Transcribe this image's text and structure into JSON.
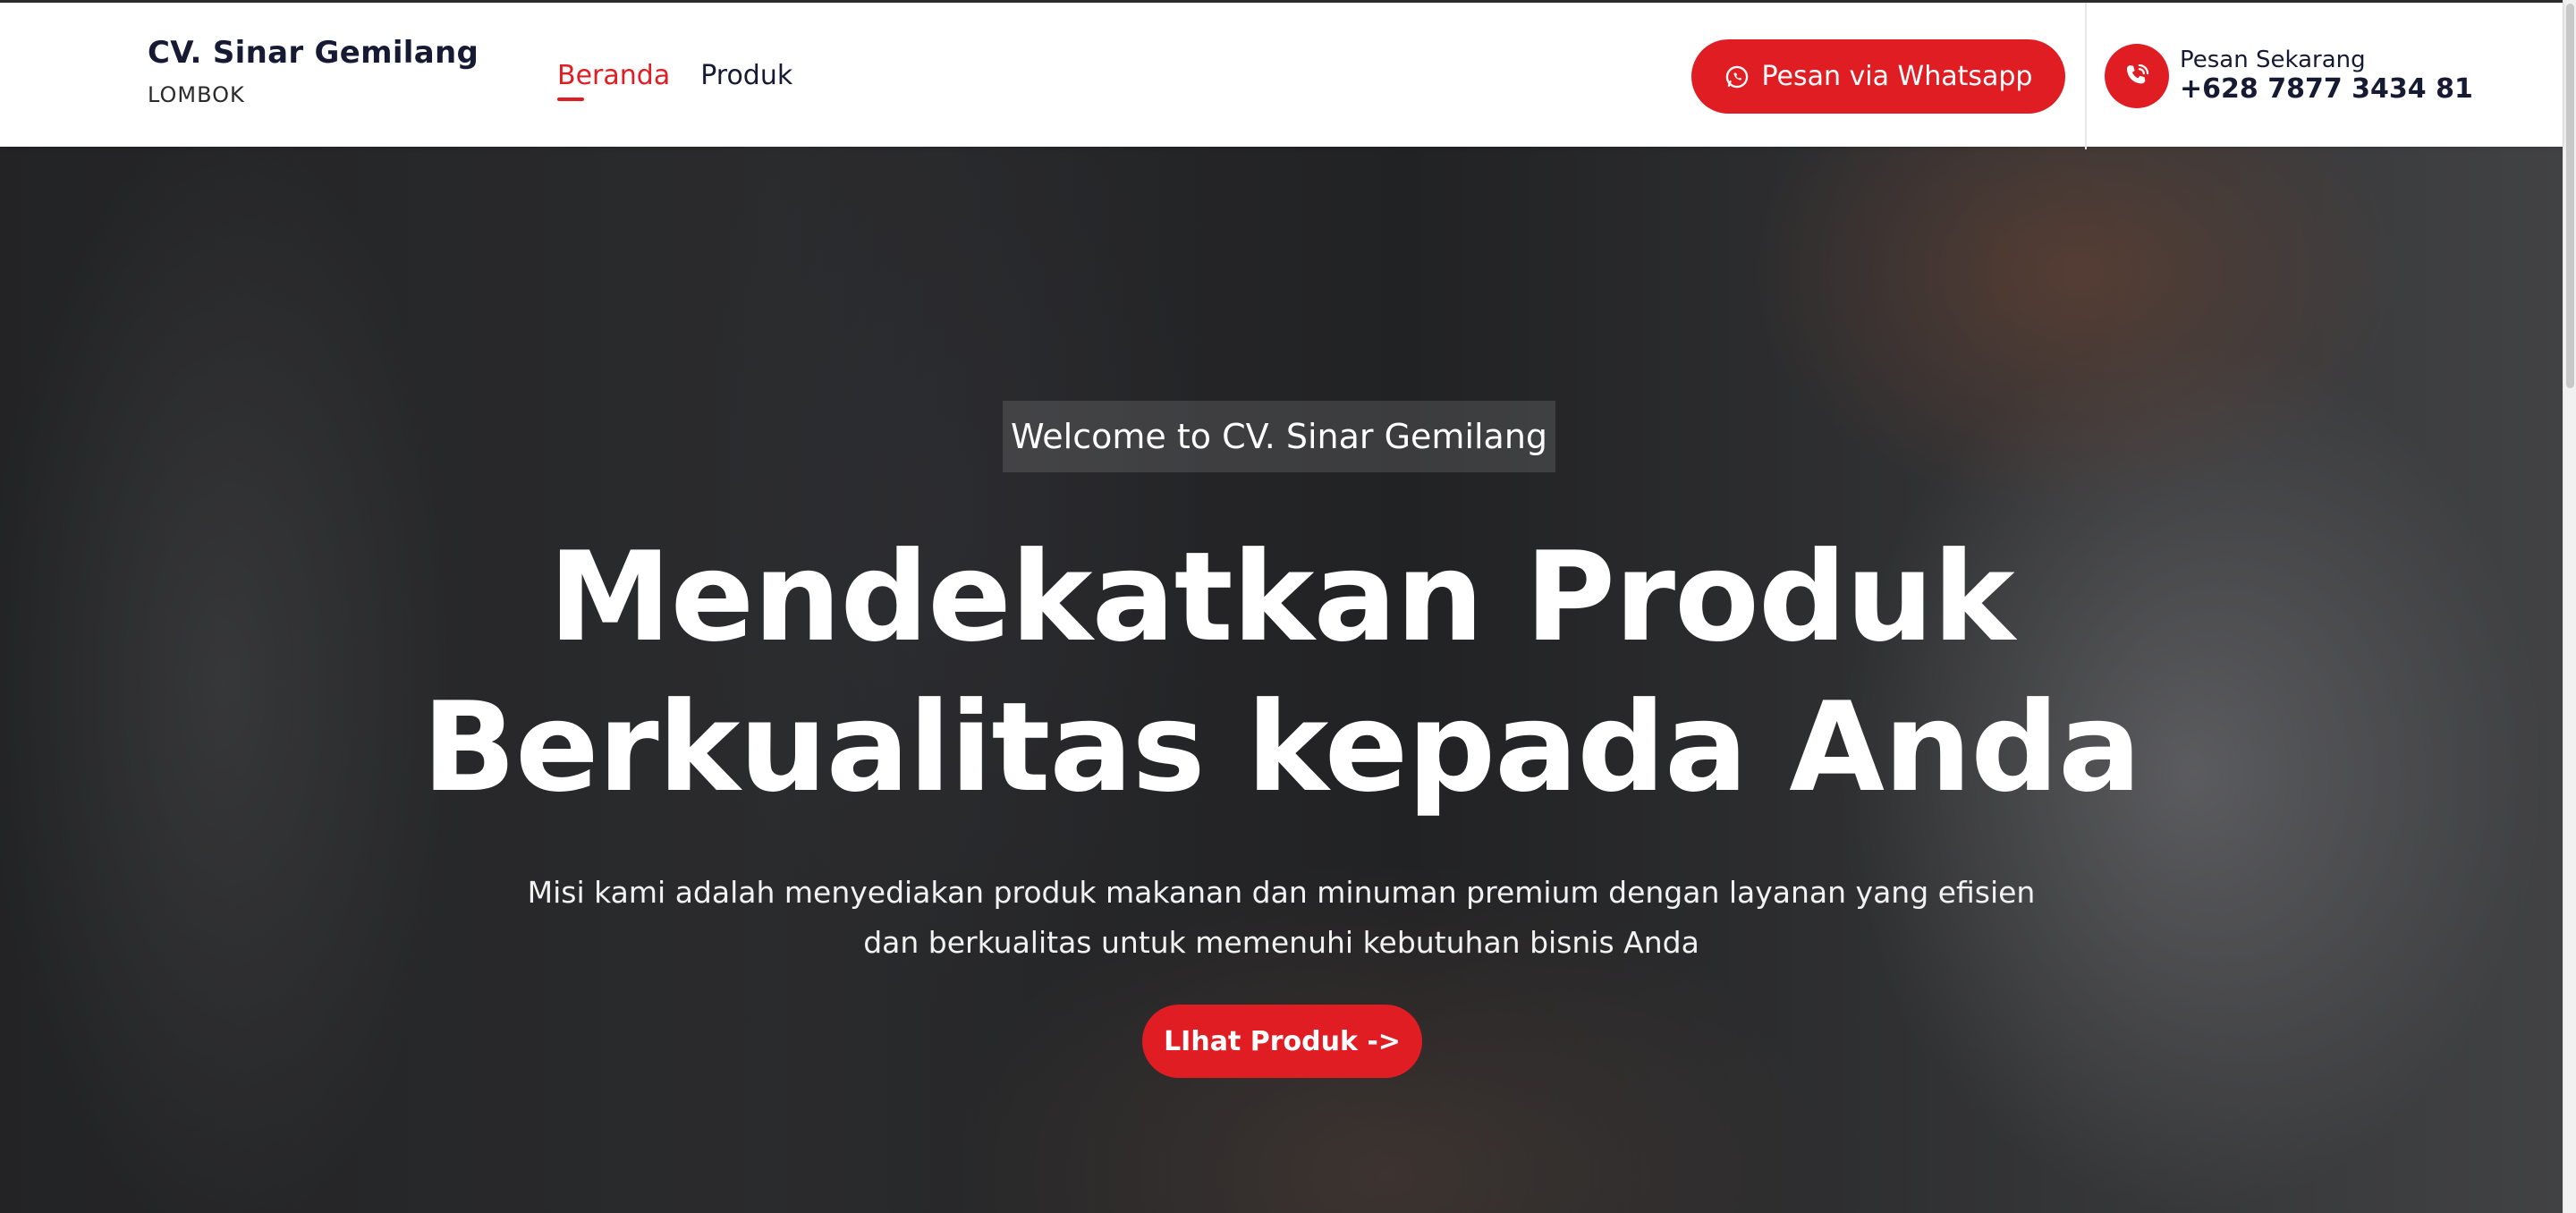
{
  "header": {
    "brand_name": "CV. Sinar Gemilang",
    "brand_sub": "LOMBOK",
    "nav": [
      {
        "label": "Beranda",
        "active": true
      },
      {
        "label": "Produk",
        "active": false
      }
    ],
    "whatsapp_button": "Pesan via Whatsapp",
    "phone_label": "Pesan Sekarang",
    "phone_number": "+628 7877 3434 81"
  },
  "hero": {
    "welcome": "Welcome to CV. Sinar Gemilang",
    "title_line1": "Mendekatkan Produk",
    "title_line2": "Berkualitas kepada Anda",
    "description": "Misi kami adalah menyediakan produk makanan dan minuman premium dengan layanan yang efisien dan berkualitas untuk memenuhi kebutuhan bisnis Anda",
    "cta": "LIhat Produk ->"
  },
  "colors": {
    "accent": "#e11d24",
    "text_dark": "#161b33"
  },
  "icons": {
    "whatsapp": "whatsapp-icon",
    "phone": "phone-icon"
  }
}
